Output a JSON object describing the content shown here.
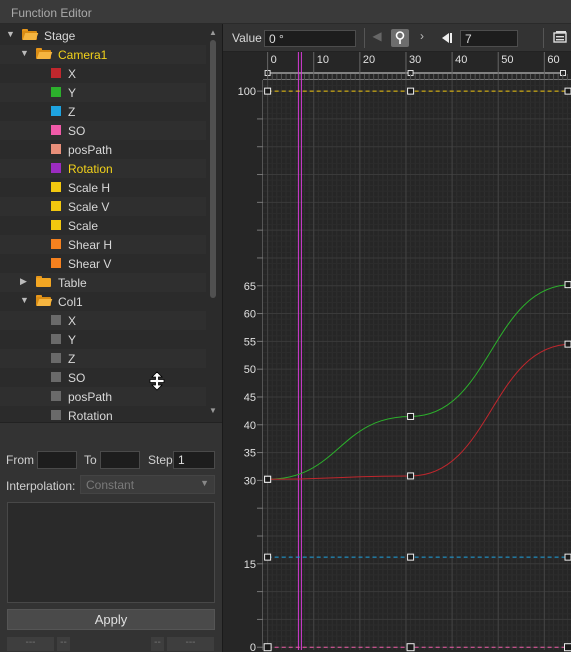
{
  "window": {
    "title": "Function Editor"
  },
  "tree": [
    {
      "label": "Stage",
      "indent": 0,
      "arrow": "down",
      "folder": "open",
      "color": null,
      "highlight": false
    },
    {
      "label": "Camera1",
      "indent": 1,
      "arrow": "down",
      "folder": "open",
      "color": null,
      "highlight": true
    },
    {
      "label": "X",
      "indent": 2,
      "color": "#c0272d",
      "highlight": false
    },
    {
      "label": "Y",
      "indent": 2,
      "color": "#2cb02c",
      "highlight": false
    },
    {
      "label": "Z",
      "indent": 2,
      "color": "#1ea3e0",
      "highlight": false
    },
    {
      "label": "SO",
      "indent": 2,
      "color": "#f05aa8",
      "highlight": false
    },
    {
      "label": "posPath",
      "indent": 2,
      "color": "#e88f7a",
      "highlight": false
    },
    {
      "label": "Rotation",
      "indent": 2,
      "color": "#9b2cc0",
      "highlight": true
    },
    {
      "label": "Scale H",
      "indent": 2,
      "color": "#f2c80f",
      "highlight": false
    },
    {
      "label": "Scale V",
      "indent": 2,
      "color": "#f2c80f",
      "highlight": false
    },
    {
      "label": "Scale",
      "indent": 2,
      "color": "#f2c80f",
      "highlight": false
    },
    {
      "label": "Shear H",
      "indent": 2,
      "color": "#f5811f",
      "highlight": false
    },
    {
      "label": "Shear V",
      "indent": 2,
      "color": "#f5811f",
      "highlight": false
    },
    {
      "label": "Table",
      "indent": 1,
      "arrow": "right",
      "folder": "closed",
      "color": null,
      "highlight": false
    },
    {
      "label": "Col1",
      "indent": 1,
      "arrow": "down",
      "folder": "open",
      "color": null,
      "highlight": false
    },
    {
      "label": "X",
      "indent": 2,
      "color": "#6a6a6a",
      "highlight": false
    },
    {
      "label": "Y",
      "indent": 2,
      "color": "#6a6a6a",
      "highlight": false
    },
    {
      "label": "Z",
      "indent": 2,
      "color": "#6a6a6a",
      "highlight": false
    },
    {
      "label": "SO",
      "indent": 2,
      "color": "#6a6a6a",
      "highlight": false
    },
    {
      "label": "posPath",
      "indent": 2,
      "color": "#6a6a6a",
      "highlight": false
    },
    {
      "label": "Rotation",
      "indent": 2,
      "color": "#6a6a6a",
      "highlight": false
    }
  ],
  "range": {
    "from_label": "From",
    "from_value": "",
    "to_label": "To",
    "to_value": "",
    "step_label": "Step",
    "step_value": "1"
  },
  "interpolation": {
    "label": "Interpolation:",
    "value": "Constant"
  },
  "apply_label": "Apply",
  "mini_buttons": [
    "---",
    "--",
    "--",
    "---"
  ],
  "toolbar": {
    "value_label": "Value",
    "value_field": "0 °",
    "frame_field": "7"
  },
  "icons": [
    "folder-icon",
    "collapse-arrow-icon",
    "expand-arrow-icon",
    "prev-key-icon",
    "key-toggle-icon",
    "next-key-icon",
    "go-to-start-icon",
    "panel-toggle-icon",
    "resize-cursor-icon",
    "dropdown-arrow-icon",
    "scroll-up-icon",
    "scroll-down-icon"
  ],
  "chart_data": {
    "type": "line",
    "x_ticks": [
      0,
      10,
      20,
      30,
      40,
      50,
      60
    ],
    "y_ticks": [
      0,
      5,
      10,
      15,
      20,
      25,
      30,
      35,
      40,
      45,
      50,
      55,
      60,
      65,
      70,
      75,
      80,
      85,
      90,
      95,
      100
    ],
    "y_tick_labels": [
      "0",
      "",
      "",
      "15",
      "",
      "",
      "30",
      "35",
      "40",
      "45",
      "50",
      "55",
      "60",
      "65",
      "",
      "",
      "",
      "",
      "",
      "",
      "100"
    ],
    "xlim": [
      -1,
      66
    ],
    "ylim": [
      -0.5,
      102
    ],
    "current_frame": 7,
    "grid": true,
    "series": [
      {
        "color": "#2cb02c",
        "style": "solid",
        "keys": [
          [
            0,
            30.2
          ],
          [
            31,
            41.5
          ],
          [
            66,
            65.2
          ]
        ]
      },
      {
        "color": "#c0272d",
        "style": "solid",
        "keys": [
          [
            0,
            30.2
          ],
          [
            31,
            30.8
          ],
          [
            66,
            54.5
          ]
        ]
      },
      {
        "color": "#f2c80f",
        "style": "dashed",
        "keys": [
          [
            0,
            100
          ],
          [
            31,
            100
          ],
          [
            66,
            100
          ]
        ]
      },
      {
        "color": "#1ea3e0",
        "style": "dashed",
        "keys": [
          [
            0,
            16.2
          ],
          [
            31,
            16.2
          ],
          [
            66,
            16.2
          ]
        ]
      },
      {
        "color": "#f05aa8",
        "style": "dashed",
        "keys": [
          [
            0,
            0
          ],
          [
            31,
            0
          ],
          [
            66,
            0
          ]
        ]
      }
    ]
  }
}
